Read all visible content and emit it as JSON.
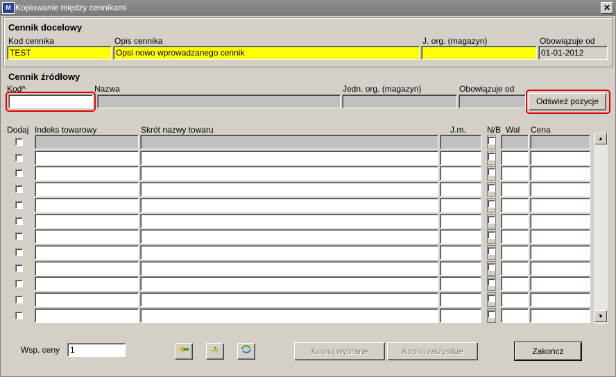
{
  "window": {
    "title": "Kopiowanie między cennikami",
    "close_symbol": "✕",
    "icon_text": "M"
  },
  "target": {
    "section_title": "Cennik docelowy",
    "labels": {
      "kod": "Kod cennika",
      "opis": "Opis cennika",
      "jorg": "J. org. (magazyn)",
      "od": "Obowiązuje od"
    },
    "values": {
      "kod": "TEST",
      "opis": "Opsi nowo wprowadzanego cennik",
      "jorg": "",
      "od": "01-01-2012"
    }
  },
  "source": {
    "section_title": "Cennik źródłowy",
    "labels": {
      "kod": "Kod^",
      "nazwa": "Nazwa",
      "jorg": "Jedn. org. (magazyn)",
      "od": "Obowiązuje od"
    },
    "values": {
      "kod": "",
      "nazwa": "",
      "jorg": "",
      "od": ""
    },
    "refresh_label": "Odśwież pozycje"
  },
  "grid": {
    "headers": {
      "dodaj": "Dodaj",
      "indeks": "Indeks towarowy",
      "skrot": "Skrót nazwy towaru",
      "jm": "J.m.",
      "nb": "N/B",
      "wal": "Wal",
      "cena": "Cena"
    }
  },
  "footer": {
    "wsp_label": "Wsp. ceny",
    "wsp_value": "1",
    "copy_selected": "Kopiuj wybrane",
    "copy_all": "Kopiuj wszystkie",
    "close": "Zakończ"
  },
  "icons": {
    "first": "select-all-icon",
    "second": "deselect-all-icon",
    "third": "invert-selection-icon"
  }
}
